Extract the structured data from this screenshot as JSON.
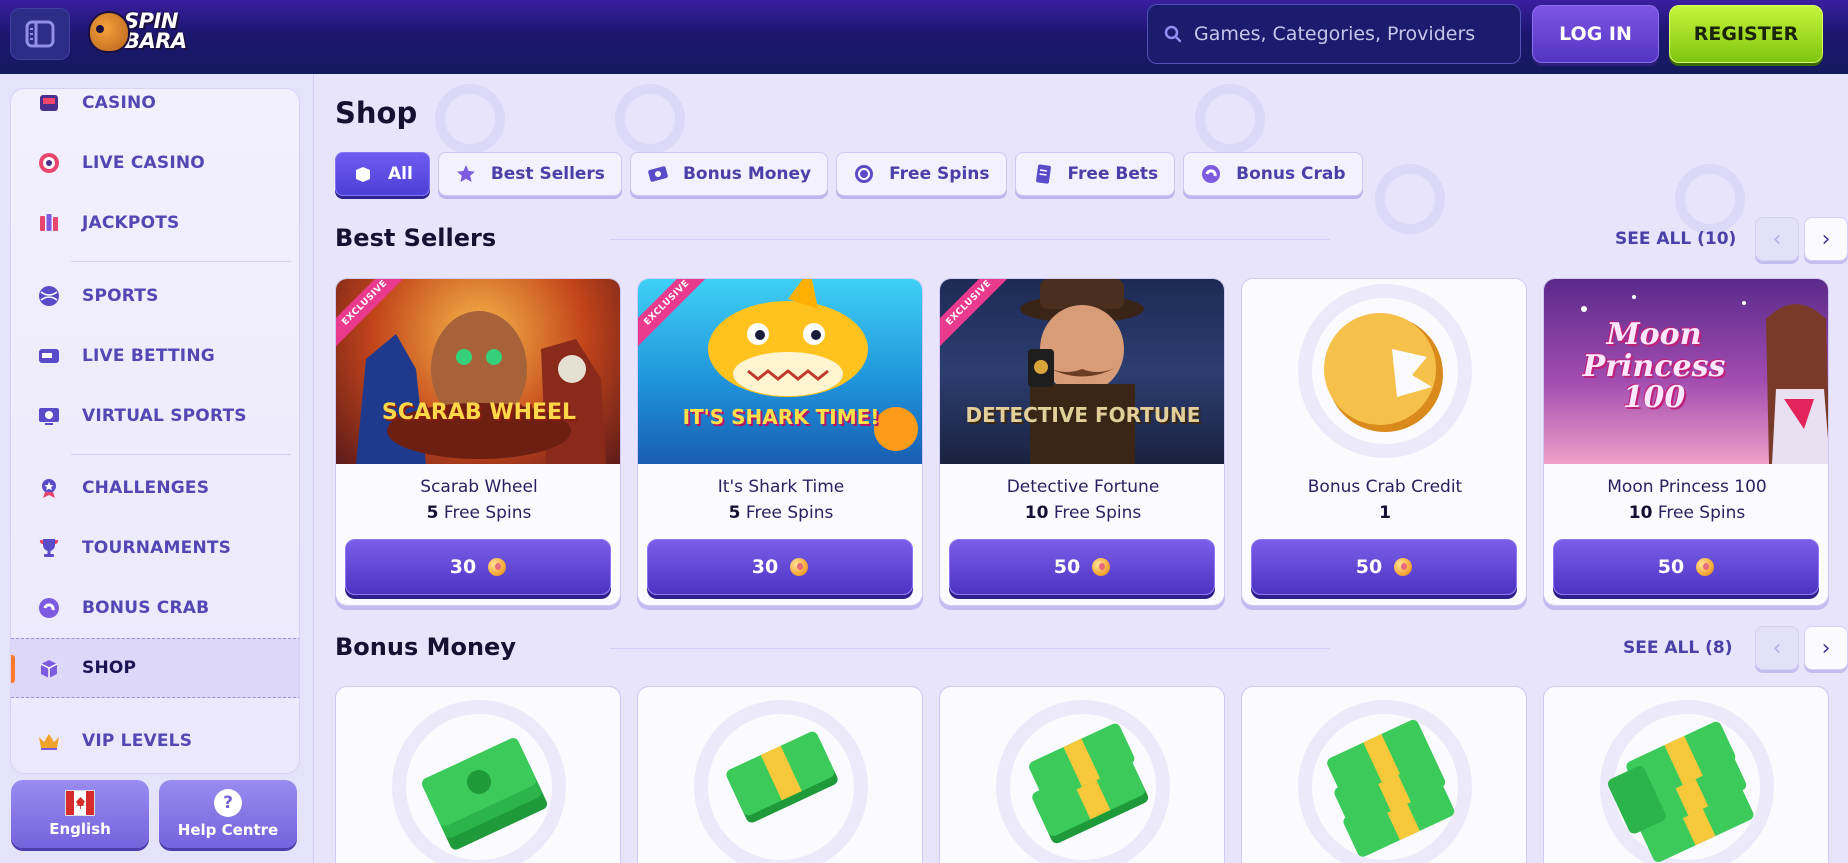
{
  "header": {
    "logo_line1": "SPIN",
    "logo_line2": "BARA",
    "search_placeholder": "Games, Categories, Providers",
    "login_label": "LOG IN",
    "register_label": "REGISTER"
  },
  "sidebar": {
    "items": [
      {
        "label": "CASINO",
        "icon": "casino-icon"
      },
      {
        "label": "LIVE CASINO",
        "icon": "live-casino-icon"
      },
      {
        "label": "JACKPOTS",
        "icon": "jackpots-icon"
      },
      {
        "label": "SPORTS",
        "icon": "sports-icon"
      },
      {
        "label": "LIVE BETTING",
        "icon": "live-betting-icon"
      },
      {
        "label": "VIRTUAL SPORTS",
        "icon": "virtual-sports-icon"
      },
      {
        "label": "CHALLENGES",
        "icon": "challenges-icon"
      },
      {
        "label": "TOURNAMENTS",
        "icon": "tournaments-icon"
      },
      {
        "label": "BONUS CRAB",
        "icon": "bonus-crab-icon"
      },
      {
        "label": "SHOP",
        "icon": "shop-icon",
        "active": true
      },
      {
        "label": "VIP LEVELS",
        "icon": "vip-crown-icon"
      }
    ],
    "language_label": "English",
    "help_label": "Help Centre",
    "help_glyph": "?"
  },
  "main": {
    "title": "Shop",
    "filters": [
      {
        "label": "All",
        "active": true
      },
      {
        "label": "Best Sellers"
      },
      {
        "label": "Bonus Money"
      },
      {
        "label": "Free Spins"
      },
      {
        "label": "Free Bets"
      },
      {
        "label": "Bonus Crab"
      }
    ],
    "best_sellers": {
      "title": "Best Sellers",
      "see_all": "SEE ALL (10)",
      "cards": [
        {
          "name": "Scarab Wheel",
          "amount": "5",
          "unit": "Free Spins",
          "price": "30",
          "badge": "EXCLUSIVE",
          "art_text": "SCARAB WHEEL"
        },
        {
          "name": "It's Shark Time",
          "amount": "5",
          "unit": "Free Spins",
          "price": "30",
          "badge": "EXCLUSIVE",
          "art_text": "IT'S SHARK TIME!"
        },
        {
          "name": "Detective Fortune",
          "amount": "10",
          "unit": "Free Spins",
          "price": "50",
          "badge": "EXCLUSIVE",
          "art_text": "DETECTIVE FORTUNE"
        },
        {
          "name": "Bonus Crab Credit",
          "amount": "1",
          "unit": "",
          "price": "50",
          "badge": "",
          "art_text": ""
        },
        {
          "name": "Moon Princess 100",
          "amount": "10",
          "unit": "Free Spins",
          "price": "50",
          "badge": "",
          "art_text": "Moon Princess 100"
        }
      ]
    },
    "bonus_money": {
      "title": "Bonus Money",
      "see_all": "SEE ALL (8)"
    }
  },
  "colors": {
    "header_bg": "#1c1670",
    "accent_purple": "#5435c3",
    "register_green": "#7fc610",
    "active_indicator": "#ff7a2a",
    "exclusive_ribbon": "#e93a8e"
  }
}
